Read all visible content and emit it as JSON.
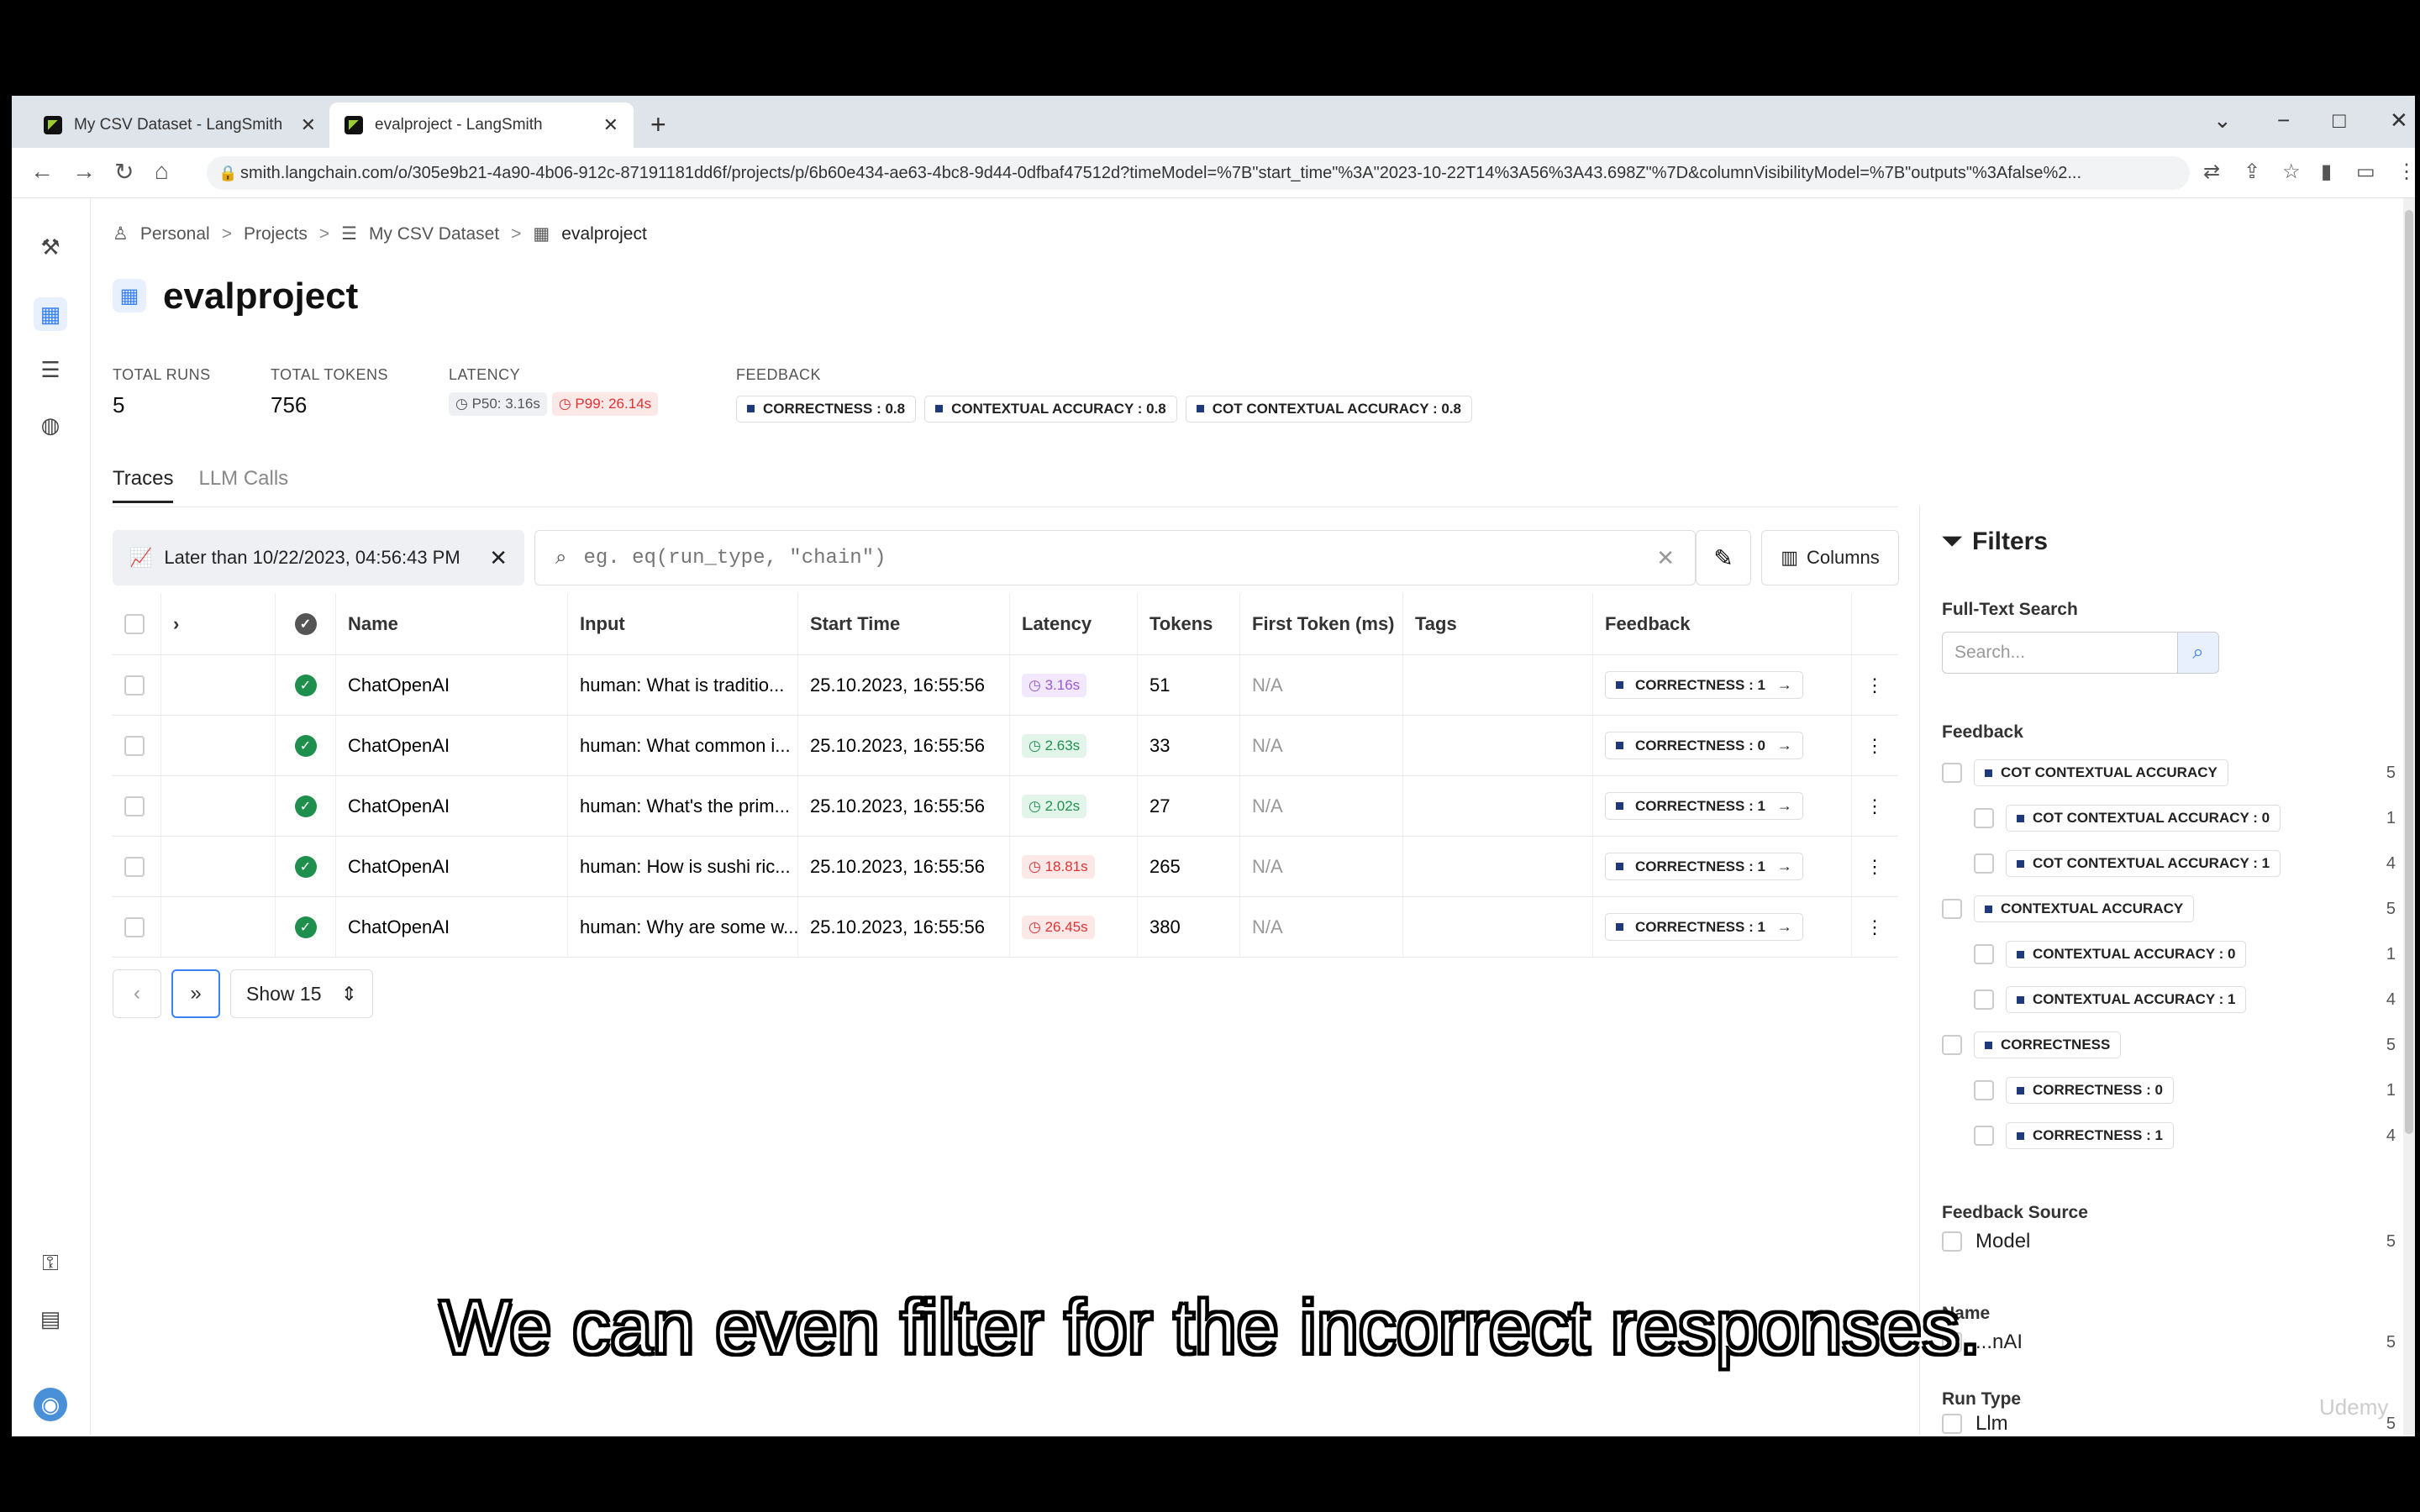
{
  "browser": {
    "tabs": [
      {
        "title": "My CSV Dataset - LangSmith",
        "close": "✕"
      },
      {
        "title": "evalproject - LangSmith",
        "close": "✕"
      }
    ],
    "new_tab": "+",
    "url": "smith.langchain.com/o/305e9b21-4a90-4b06-912c-87191181dd6f/projects/p/6b60e434-ae63-4bc8-9d44-0dfbaf47512d?timeModel=%7B\"start_time\"%3A\"2023-10-22T14%3A56%3A43.698Z\"%7D&columnVisibilityModel=%7B\"outputs\"%3Afalse%2..."
  },
  "breadcrumb": {
    "items": [
      "Personal",
      "Projects",
      "My CSV Dataset",
      "evalproject"
    ],
    "sep": ">"
  },
  "page_title": "evalproject",
  "stats": {
    "total_runs_label": "TOTAL RUNS",
    "total_runs": "5",
    "total_tokens_label": "TOTAL TOKENS",
    "total_tokens": "756",
    "latency_label": "LATENCY",
    "p50": "P50: 3.16s",
    "p99": "P99: 26.14s",
    "feedback_label": "FEEDBACK",
    "feedback": [
      "CORRECTNESS : 0.8",
      "CONTEXTUAL ACCURACY : 0.8",
      "COT CONTEXTUAL ACCURACY : 0.8"
    ]
  },
  "tabs": [
    "Traces",
    "LLM Calls"
  ],
  "toolbar": {
    "date_filter": "Later than 10/22/2023, 04:56:43 PM",
    "search_placeholder": "eg. eq(run_type, \"chain\")",
    "columns_label": "Columns"
  },
  "table": {
    "headers": [
      "Name",
      "Input",
      "Start Time",
      "Latency",
      "Tokens",
      "First Token (ms)",
      "Tags",
      "Feedback"
    ],
    "rows": [
      {
        "name": "ChatOpenAI",
        "input": "human: What is traditio...",
        "start": "25.10.2023, 16:55:56",
        "latency": "3.16s",
        "lat_color": "purple",
        "tokens": "51",
        "first_token": "N/A",
        "feedback": "CORRECTNESS : 1"
      },
      {
        "name": "ChatOpenAI",
        "input": "human: What common i...",
        "start": "25.10.2023, 16:55:56",
        "latency": "2.63s",
        "lat_color": "green",
        "tokens": "33",
        "first_token": "N/A",
        "feedback": "CORRECTNESS : 0"
      },
      {
        "name": "ChatOpenAI",
        "input": "human: What's the prim...",
        "start": "25.10.2023, 16:55:56",
        "latency": "2.02s",
        "lat_color": "green",
        "tokens": "27",
        "first_token": "N/A",
        "feedback": "CORRECTNESS : 1"
      },
      {
        "name": "ChatOpenAI",
        "input": "human: How is sushi ric...",
        "start": "25.10.2023, 16:55:56",
        "latency": "18.81s",
        "lat_color": "red",
        "tokens": "265",
        "first_token": "N/A",
        "feedback": "CORRECTNESS : 1"
      },
      {
        "name": "ChatOpenAI",
        "input": "human: Why are some w...",
        "start": "25.10.2023, 16:55:56",
        "latency": "26.45s",
        "lat_color": "red",
        "tokens": "380",
        "first_token": "N/A",
        "feedback": "CORRECTNESS : 1"
      }
    ]
  },
  "pager": {
    "show": "Show 15"
  },
  "filters": {
    "title": "Filters",
    "fulltext_label": "Full-Text Search",
    "search_placeholder": "Search...",
    "feedback_label": "Feedback",
    "feedback_items": [
      {
        "label": "COT CONTEXTUAL ACCURACY",
        "count": "5",
        "sub": false
      },
      {
        "label": "COT CONTEXTUAL ACCURACY : 0",
        "count": "1",
        "sub": true
      },
      {
        "label": "COT CONTEXTUAL ACCURACY : 1",
        "count": "4",
        "sub": true
      },
      {
        "label": "CONTEXTUAL ACCURACY",
        "count": "5",
        "sub": false
      },
      {
        "label": "CONTEXTUAL ACCURACY : 0",
        "count": "1",
        "sub": true
      },
      {
        "label": "CONTEXTUAL ACCURACY : 1",
        "count": "4",
        "sub": true
      },
      {
        "label": "CORRECTNESS",
        "count": "5",
        "sub": false
      },
      {
        "label": "CORRECTNESS : 0",
        "count": "1",
        "sub": true
      },
      {
        "label": "CORRECTNESS : 1",
        "count": "4",
        "sub": true
      }
    ],
    "source_label": "Feedback Source",
    "source_item": "Model",
    "source_count": "5",
    "name_label": "Name",
    "name_item": "...nAI",
    "name_count": "5",
    "runtype_label": "Run Type",
    "runtype_item": "Llm",
    "runtype_count": "5"
  },
  "caption": "We can even filter for the incorrect responses.",
  "watermark": "Udemy"
}
